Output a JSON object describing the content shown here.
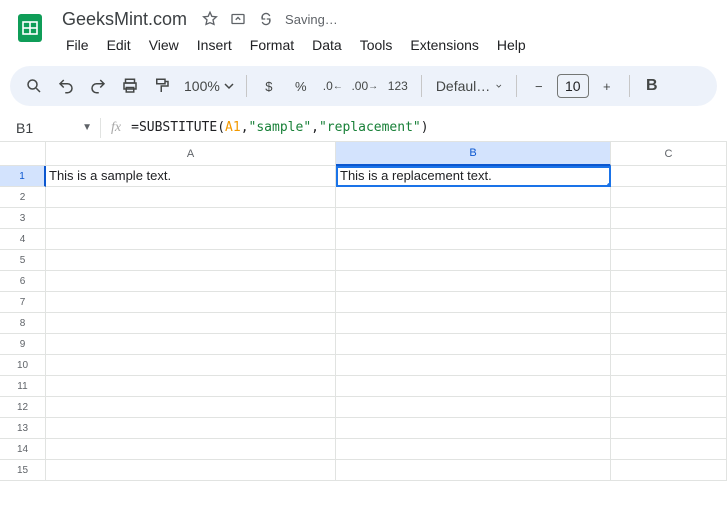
{
  "doc": {
    "title": "GeeksMint.com",
    "status": "Saving…"
  },
  "menu": [
    "File",
    "Edit",
    "View",
    "Insert",
    "Format",
    "Data",
    "Tools",
    "Extensions",
    "Help"
  ],
  "toolbar": {
    "zoom": "100%",
    "font_name": "Defaul…",
    "font_size": "10",
    "number_fmt": "123"
  },
  "name_box": "B1",
  "formula": {
    "prefix": "=",
    "fn": "SUBSTITUTE",
    "open": "(",
    "ref": "A1",
    "c1": ", ",
    "s1": "\"sample\"",
    "c2": ", ",
    "s2": "\"replacement\"",
    "close": ")"
  },
  "columns": [
    "A",
    "B",
    "C"
  ],
  "cells": {
    "A1": "This is a sample text.",
    "B1": "This is a replacement text."
  },
  "active_cell": "B1",
  "row_count": 15
}
